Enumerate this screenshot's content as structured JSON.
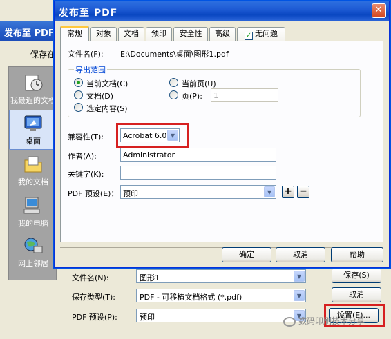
{
  "background_window": {
    "title": "发布至 PDF",
    "save_in_label": "保存在",
    "places": [
      {
        "label": "我最近的文档",
        "icon": "recent-documents-icon"
      },
      {
        "label": "桌面",
        "icon": "desktop-icon"
      },
      {
        "label": "我的文档",
        "icon": "my-documents-icon"
      },
      {
        "label": "我的电脑",
        "icon": "my-computer-icon"
      },
      {
        "label": "网上邻居",
        "icon": "network-places-icon"
      }
    ],
    "file_name_label": "文件名(N):",
    "file_name_value": "图形1",
    "save_type_label": "保存类型(T):",
    "save_type_value": "PDF - 可移植文档格式 (*.pdf)",
    "pdf_preset_label": "PDF 预设(P):",
    "pdf_preset_value": "预印",
    "save_button": "保存(S)",
    "cancel_button": "取消",
    "settings_button": "设置(E)...",
    "watermark": "数码印刷技术分享"
  },
  "dialog": {
    "title": "发布至 PDF",
    "close_glyph": "✕",
    "tabs": [
      "常规",
      "对象",
      "文档",
      "预印",
      "安全性",
      "高级",
      "无问题"
    ],
    "active_tab": 0,
    "file_name_label": "文件名(F):",
    "file_name_value": "E:\\Documents\\桌面\\图形1.pdf",
    "export_range": {
      "title": "导出范围",
      "current_document": "当前文档(C)",
      "documents": "文档(D)",
      "selection": "选定内容(S)",
      "current_page": "当前页(U)",
      "pages": "页(P):",
      "pages_value": "1"
    },
    "compatibility_label": "兼容性(T):",
    "compatibility_value": "Acrobat 6.0",
    "author_label": "作者(A):",
    "author_value": "Administrator",
    "keywords_label": "关键字(K):",
    "keywords_value": "",
    "pdf_preset_label": "PDF 预设(E)：",
    "pdf_preset_value": "预印",
    "add_preset_glyph": "+",
    "remove_preset_glyph": "−",
    "ok_button": "确定",
    "cancel_button": "取消",
    "help_button": "帮助"
  },
  "colors": {
    "highlight": "#d62020",
    "titlebar": "#1e5bd4",
    "accent_tab": "#ffc83c"
  }
}
